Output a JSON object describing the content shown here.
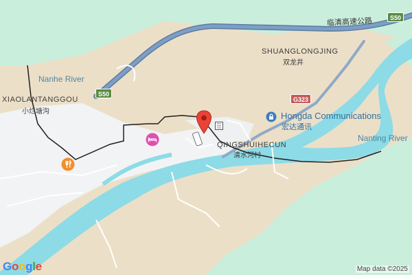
{
  "map": {
    "highway": {
      "shield": "S50",
      "name": "临清高速公路"
    },
    "national_road": {
      "shield": "G323"
    },
    "places": [
      {
        "en": "SHUANGLONGJING",
        "cn": "双龙井"
      },
      {
        "en": "XIAOLANTANGGOU",
        "cn": "小烂塘沟"
      },
      {
        "en": "QINGSHUIHECUN",
        "cn": "清水河村"
      }
    ],
    "rivers": [
      "Nanhe River",
      "Nanting River"
    ],
    "poi": {
      "en": "Hongda Communications",
      "cn": "宏达通讯",
      "icon": "lock-icon"
    },
    "icons": {
      "hotel": "bed-icon",
      "restaurant": "fork-knife-icon",
      "pin": "location-pin-icon"
    },
    "attribution": "Map data ©2025",
    "logo": "Google",
    "colors": {
      "land": "#ecdfc8",
      "forest": "#c9eedc",
      "urban": "#f1f3f4",
      "water": "#8ddbe6",
      "highway": "#6e8fb3",
      "pin": "#ea4335",
      "poi": "#2f6f9f"
    }
  }
}
